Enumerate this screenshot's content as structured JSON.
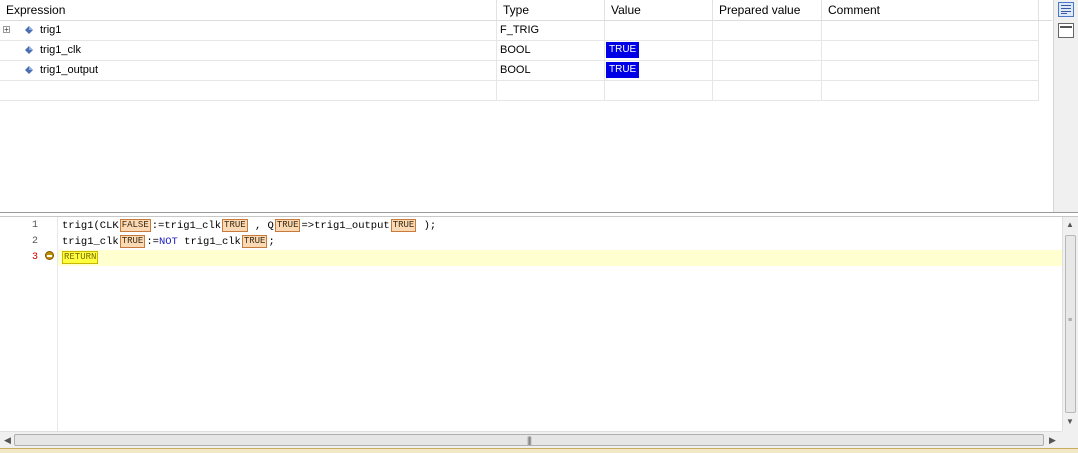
{
  "watch": {
    "columns": [
      "Expression",
      "Type",
      "Value",
      "Prepared value",
      "Comment"
    ],
    "rows": [
      {
        "expression": "trig1",
        "type": "F_TRIG",
        "value": "",
        "expander": "+"
      },
      {
        "expression": "trig1_clk",
        "type": "BOOL",
        "value": "TRUE"
      },
      {
        "expression": "trig1_output",
        "type": "BOOL",
        "value": "TRUE"
      }
    ]
  },
  "editor": {
    "line_numbers": [
      "1",
      "2",
      "3"
    ],
    "line1": {
      "p1": "trig1(CLK",
      "v1": "FALSE",
      "p2": ":=trig1_clk",
      "v2": "TRUE",
      "p3": " , Q",
      "v3": "TRUE",
      "p4": "=>trig1_output",
      "v4": "TRUE",
      "p5": " );"
    },
    "line2": {
      "p1": "trig1_clk",
      "v1": "TRUE",
      "p2": ":=",
      "kw": "NOT",
      "p3": " trig1_clk",
      "v2": "TRUE",
      "p4": ";"
    },
    "line3": {
      "ret": "RETURN"
    }
  },
  "icons": {
    "expander": "plus-expander-icon",
    "variable": "variable-diamond-icon",
    "breakpoint": "breakpoint-current-icon"
  },
  "colors": {
    "value_badge_bg": "#0000e6",
    "inline_value_bg": "#fbd9b4",
    "current_line_bg": "#ffffd0",
    "return_highlight": "#ffff40"
  }
}
